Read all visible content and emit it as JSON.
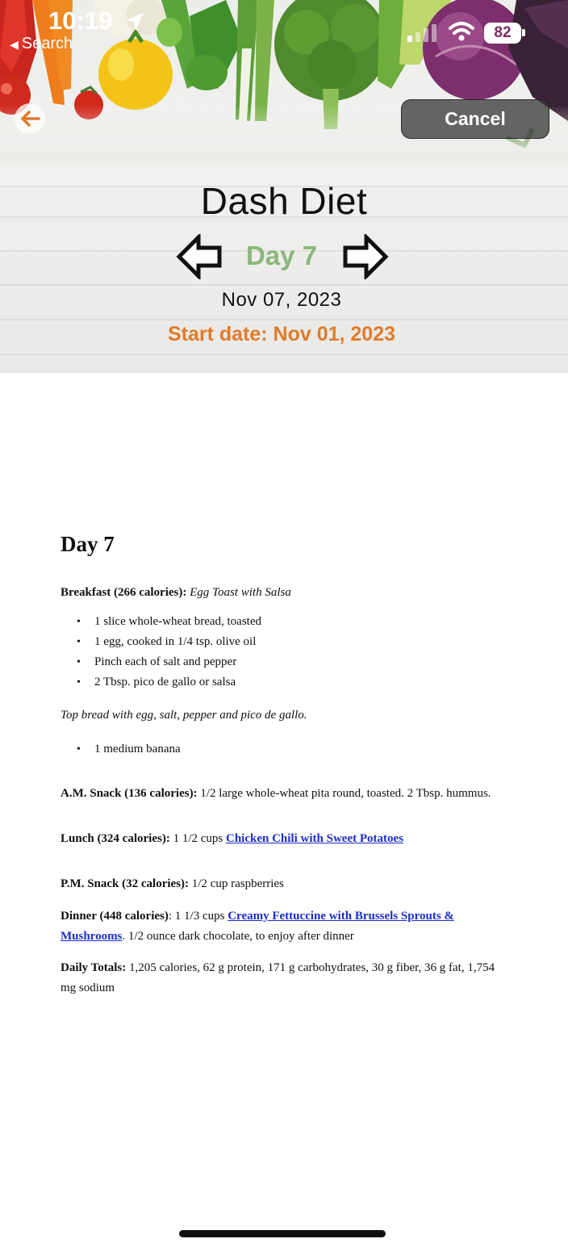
{
  "status_bar": {
    "time": "10:19",
    "back_label": "Search",
    "battery": "82"
  },
  "header": {
    "cancel_label": "Cancel",
    "title": "Dash Diet",
    "day_label": "Day 7",
    "date": "Nov 07, 2023",
    "start_date": "Start date: Nov 01, 2023"
  },
  "document": {
    "heading": "Day 7",
    "breakfast_label": "Breakfast (266 calories):",
    "breakfast_recipe": "Egg Toast with Salsa",
    "breakfast_items": [
      "1 slice whole-wheat bread, toasted",
      "1 egg, cooked in 1/4 tsp. olive oil",
      "Pinch each of salt and pepper",
      "2 Tbsp. pico de gallo or salsa"
    ],
    "breakfast_note": "Top bread with egg, salt, pepper and pico de gallo.",
    "extra_items": [
      "1 medium banana"
    ],
    "am_snack_label": "A.M. Snack (136 calories):",
    "am_snack_text": "1/2 large whole-wheat pita round, toasted. 2 Tbsp. hummus.",
    "lunch_label": "Lunch (324 calories):",
    "lunch_text": "1 1/2 cups",
    "lunch_link": "Chicken Chili with Sweet Potatoes",
    "pm_snack_label": "P.M. Snack (32 calories):",
    "pm_snack_text": "1/2 cup raspberries",
    "dinner_label": "Dinner (448 calories)",
    "dinner_text": ": 1 1/3 cups",
    "dinner_link": "Creamy Fettuccine with Brussels Sprouts & Mushrooms",
    "dinner_after": ". 1/2 ounce dark chocolate, to enjoy after dinner",
    "totals_label": "Daily Totals:",
    "totals_text": "1,205 calories, 62 g protein, 171 g carbohydrates, 30 g fiber, 36 g fat, 1,754 mg sodium"
  },
  "colors": {
    "day_green": "#89b77a",
    "start_orange": "#e07b2a",
    "link_blue": "#1b2dcc",
    "back_arrow_orange": "#e07b2a"
  },
  "icons": {
    "back": "arrow-left-icon",
    "prev_day": "hollow-arrow-left-icon",
    "next_day": "hollow-arrow-right-icon",
    "location": "location-arrow-icon",
    "wifi": "wifi-icon",
    "signal": "cellular-signal-icon",
    "battery": "battery-icon"
  }
}
